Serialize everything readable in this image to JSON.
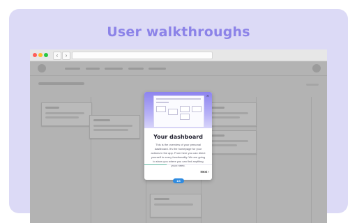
{
  "hero": {
    "title": "User walkthroughs"
  },
  "modal": {
    "title": "Your dashboard",
    "body": "This is the overview of your personal dashboard. It's the homepage for your actions in the app. From here you can direct yourself to every functionality. We are going to show you where you can find anything you'll need.",
    "close": "×",
    "next": "Next ›",
    "progress_fraction": 0.33,
    "step": "1/3"
  },
  "colors": {
    "accent": "#8c83e8",
    "card_bg": "#dcdaf6",
    "pill": "#2f8be0",
    "progress": "#5fb5a0"
  }
}
